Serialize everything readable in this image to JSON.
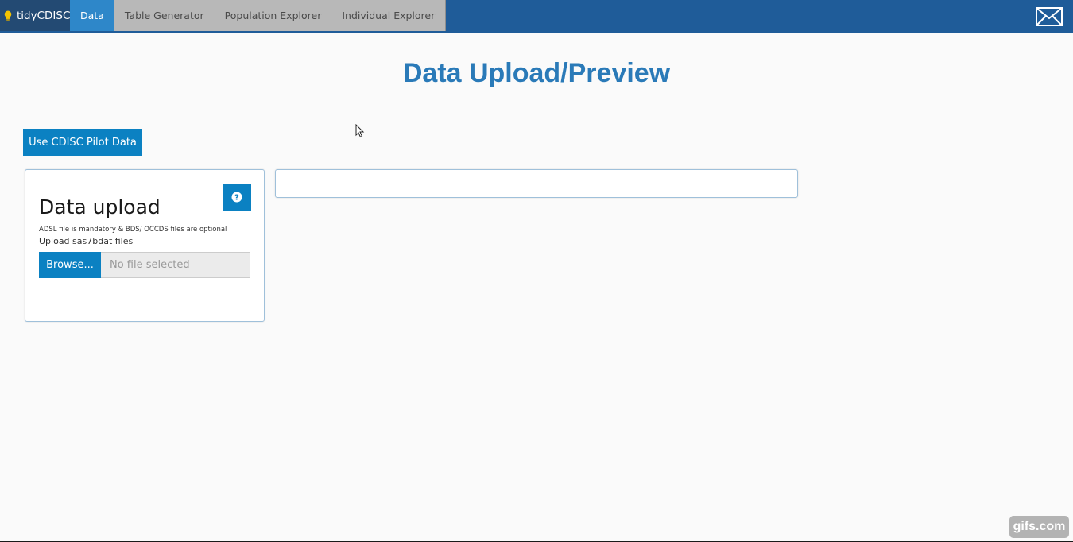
{
  "navbar": {
    "brand": "tidyCDISC",
    "tabs": [
      {
        "label": "Data",
        "active": true
      },
      {
        "label": "Table Generator",
        "active": false
      },
      {
        "label": "Population Explorer",
        "active": false
      },
      {
        "label": "Individual Explorer",
        "active": false
      }
    ],
    "icons": {
      "brand": "lightbulb-icon",
      "contact": "envelope-icon"
    }
  },
  "main": {
    "title": "Data Upload/Preview",
    "pilot_button": "Use CDISC Pilot Data"
  },
  "upload_panel": {
    "title": "Data upload",
    "note": "ADSL file is mandatory & BDS/ OCCDS files are optional",
    "upload_label": "Upload sas7bdat files",
    "browse_label": "Browse...",
    "file_placeholder": "No file selected",
    "help_icon": "question-circle-icon"
  },
  "watermark": "gifs.com",
  "colors": {
    "navbar": "#1f5c99",
    "active_tab": "#2e87c9",
    "inactive_tab": "#b8b8b8",
    "button": "#0b81c2",
    "title": "#2a7ab8"
  }
}
